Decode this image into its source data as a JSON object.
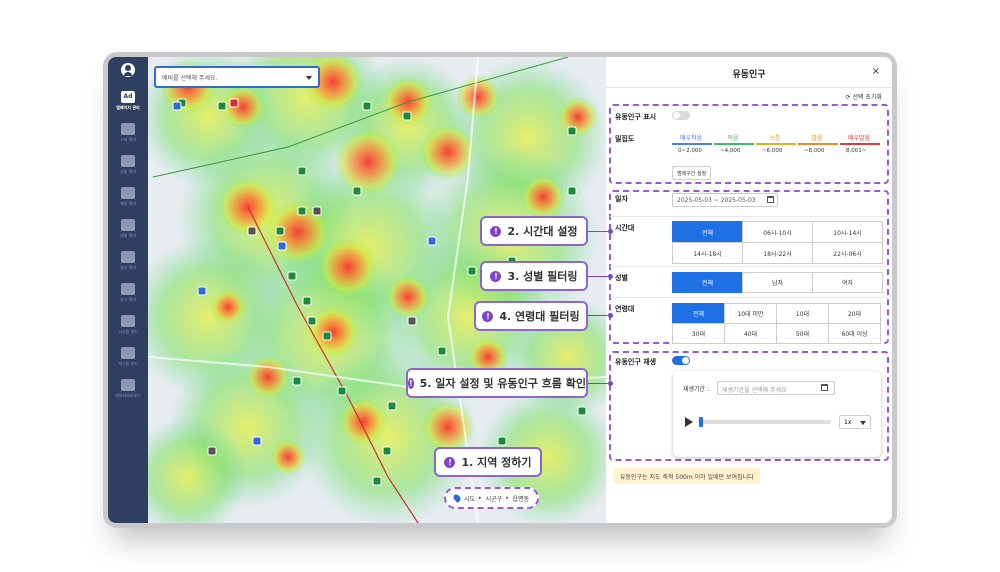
{
  "sidebar": {
    "items": [
      {
        "label": "맵페이지 관리",
        "icon": "ad-icon",
        "active": true
      },
      {
        "label": "소재 관리",
        "icon": "building-icon",
        "active": false
      },
      {
        "label": "상품 관리",
        "icon": "shapes-icon",
        "active": false
      },
      {
        "label": "계정 관리",
        "icon": "users-icon",
        "active": false
      },
      {
        "label": "매체 관리",
        "icon": "pin-icon",
        "active": false
      },
      {
        "label": "정산 관리",
        "icon": "money-bag-icon",
        "active": false
      },
      {
        "label": "광고 관리",
        "icon": "document-icon",
        "active": false
      },
      {
        "label": "시스템 관리",
        "icon": "gear-icon",
        "active": false
      },
      {
        "label": "게시물 관리",
        "icon": "bell-icon",
        "active": false
      },
      {
        "label": "캐릭터아트보드",
        "icon": "image-icon",
        "active": false
      }
    ]
  },
  "map": {
    "region_placeholder": "예비를 선택해 주세요.",
    "breadcrumb": {
      "sido": "시도",
      "sigungu": "시군구",
      "dong": "읍면동"
    }
  },
  "callouts": {
    "c1": {
      "num": "!",
      "text": "1. 지역 정하기"
    },
    "c2": {
      "num": "!",
      "text": "2. 시간대 설정"
    },
    "c3": {
      "num": "!",
      "text": "3. 성별 필터링"
    },
    "c4": {
      "num": "!",
      "text": "4. 연령대 필터링"
    },
    "c5": {
      "num": "!",
      "text": "5. 일자 설정 및 유동인구 흐름 확인"
    }
  },
  "panel": {
    "title": "유동인구",
    "close": "×",
    "reset": "⟳ 선택 초기화",
    "show_label": "유동인구 표시",
    "density_label": "밀집도",
    "density": [
      {
        "name": "매우적음",
        "range": "0~2,000",
        "color": "#4a7ff0"
      },
      {
        "name": "적음",
        "range": "~4,000",
        "color": "#3cb96a"
      },
      {
        "name": "보통",
        "range": "~6,000",
        "color": "#e0b020"
      },
      {
        "name": "많음",
        "range": "~8,000",
        "color": "#f08a24"
      },
      {
        "name": "매우많음",
        "range": "8,001~",
        "color": "#e33a3a"
      }
    ],
    "range_setting": "범례구간 설정",
    "date_label": "일자",
    "date_value": "2025-05-03 ~ 2025-05-03",
    "time_label": "시간대",
    "time_options": [
      "전체",
      "06시-10시",
      "10시-14시",
      "14시-18시",
      "18시-22시",
      "22시-06시"
    ],
    "gender_label": "성별",
    "gender_options": [
      "전체",
      "남자",
      "여자"
    ],
    "age_label": "연령대",
    "age_options": [
      "전체",
      "10대 미만",
      "10대",
      "20대",
      "30대",
      "40대",
      "50대",
      "60대 이상"
    ],
    "replay_label": "유동인구 재생",
    "replay_period_label": "재생기간 :",
    "replay_period_placeholder": "재생기간을 선택해 주세요",
    "speed": "1x",
    "note": "유동인구는 지도 축척 500m 이하 일때만 보여집니다"
  }
}
